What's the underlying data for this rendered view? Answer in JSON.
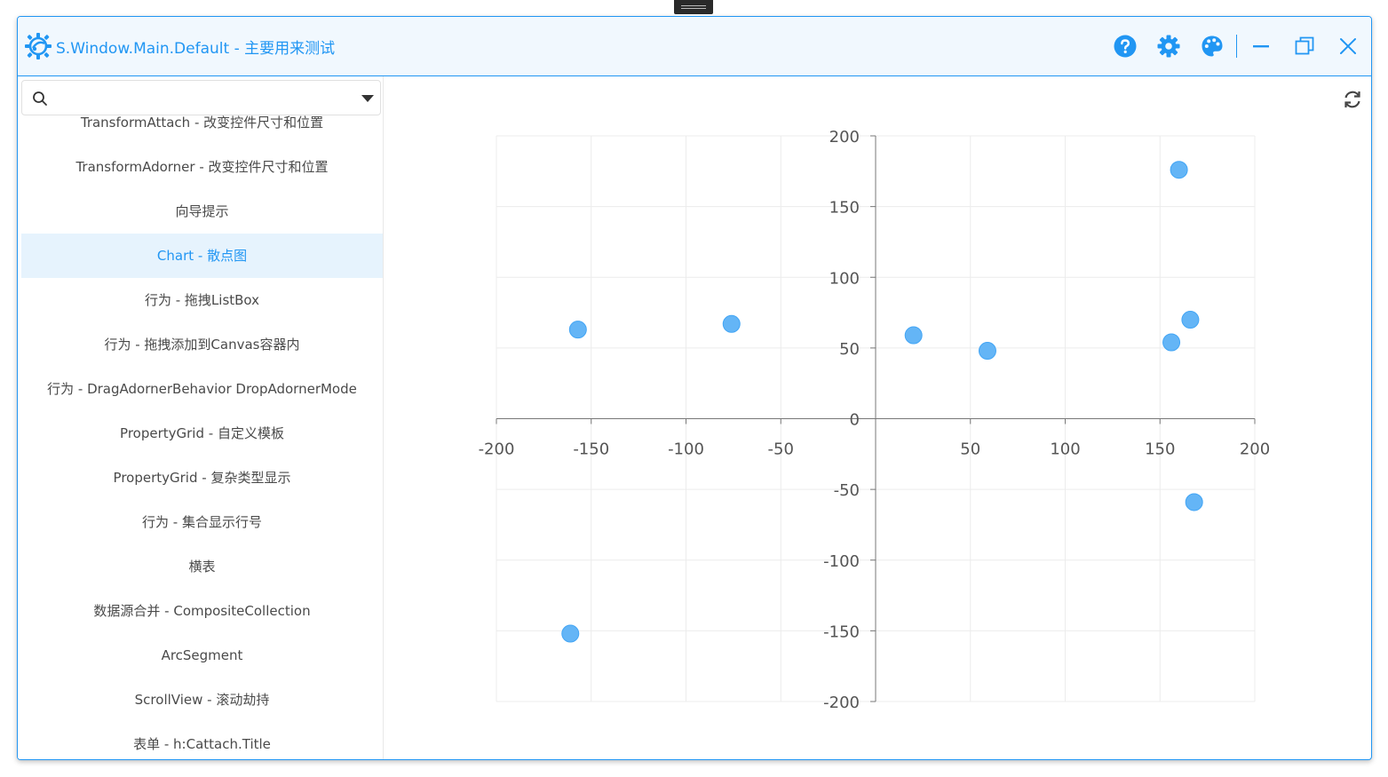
{
  "window": {
    "title": "S.Window.Main.Default - 主要用来测试",
    "app_icon": "gear-app-icon",
    "buttons": [
      "help-icon",
      "settings-icon",
      "palette-icon",
      "minimize-icon",
      "restore-icon",
      "close-icon"
    ],
    "accent_color": "#2196f3"
  },
  "sidebar": {
    "search": {
      "value": "",
      "placeholder": ""
    },
    "items": [
      {
        "label": "TransformAttach - 改变控件尺寸和位置"
      },
      {
        "label": "TransformAdorner - 改变控件尺寸和位置"
      },
      {
        "label": "向导提示"
      },
      {
        "label": "Chart - 散点图",
        "selected": true
      },
      {
        "label": "行为 - 拖拽ListBox"
      },
      {
        "label": "行为 - 拖拽添加到Canvas容器内"
      },
      {
        "label": "行为 - DragAdornerBehavior DropAdornerMode"
      },
      {
        "label": "PropertyGrid - 自定义模板"
      },
      {
        "label": "PropertyGrid - 复杂类型显示"
      },
      {
        "label": "行为 - 集合显示行号"
      },
      {
        "label": "横表"
      },
      {
        "label": "数据源合并 - CompositeCollection"
      },
      {
        "label": "ArcSegment"
      },
      {
        "label": "ScrollView - 滚动劫持"
      },
      {
        "label": "表单 - h:Cattach.Title"
      }
    ]
  },
  "main": {
    "refresh_icon": "refresh-icon"
  },
  "chart_data": {
    "type": "scatter",
    "xlim": [
      -200,
      200
    ],
    "ylim": [
      -200,
      200
    ],
    "xticks": [
      -200,
      -150,
      -100,
      -50,
      50,
      100,
      150,
      200
    ],
    "yticks": [
      200,
      150,
      100,
      50,
      0,
      -50,
      -100,
      -150,
      -200
    ],
    "grid": true,
    "point_color": "#64b5f6",
    "points": [
      {
        "x": -157,
        "y": 63
      },
      {
        "x": -76,
        "y": 67
      },
      {
        "x": 20,
        "y": 59
      },
      {
        "x": 59,
        "y": 48
      },
      {
        "x": 160,
        "y": 176
      },
      {
        "x": 166,
        "y": 70
      },
      {
        "x": 156,
        "y": 54
      },
      {
        "x": 168,
        "y": -59
      },
      {
        "x": -161,
        "y": -152
      }
    ]
  }
}
